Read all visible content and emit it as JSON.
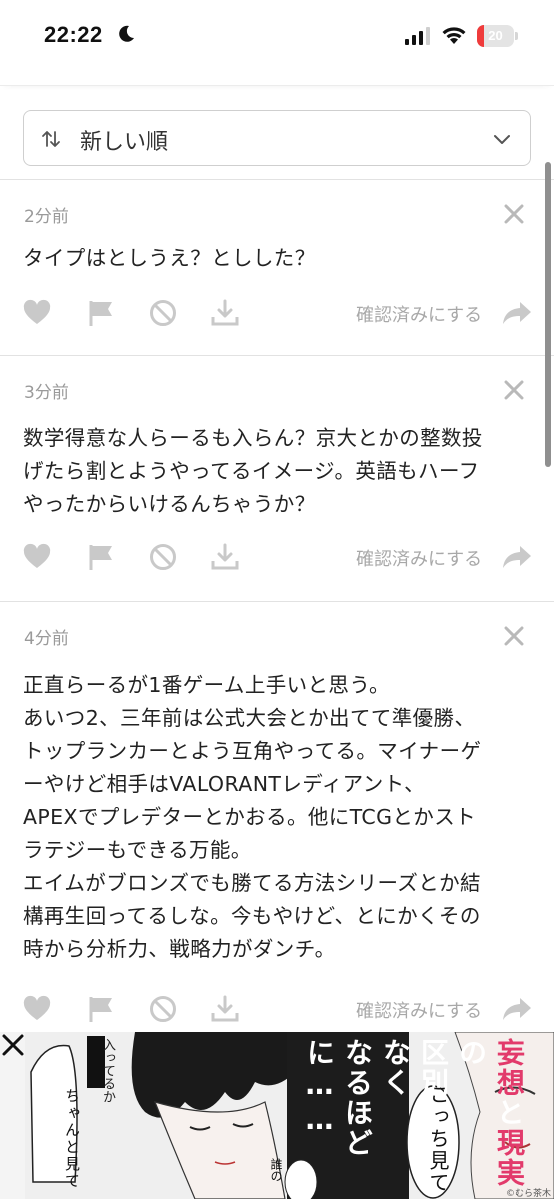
{
  "status_bar": {
    "time": "22:22",
    "battery": "20",
    "battery_level": 0.2,
    "battery_color": "#ef3b3b"
  },
  "sort": {
    "label": "新しい順"
  },
  "comments": [
    {
      "time": "2分前",
      "lines": [
        "タイプはとしうえ？としした？"
      ],
      "confirm_label": "確認済みにする"
    },
    {
      "time": "3分前",
      "lines": [
        "数学得意な人らーるも入らん？京大とかの整数投",
        "げたら割とようやってるイメージ。英語もハーフ",
        "やったからいけるんちゃうか？"
      ],
      "confirm_label": "確認済みにする"
    },
    {
      "time": "4分前",
      "lines": [
        "正直らーるが1番ゲーム上手いと思う。",
        "あいつ2、三年前は公式大会とか出てて準優勝、",
        "トップランカーとよう互角やってる。マイナーゲ",
        "ーやけど相手はVALORANTレディアント、",
        "APEXでプレデターとかおる。他にTCGとかスト",
        "ラテジーもできる万能。",
        "エイムがブロンズでも勝てる方法シリーズとか結",
        "構再生回ってるしな。今もやけど、とにかくその",
        "時から分析力、戦略力がダンチ。"
      ],
      "confirm_label": "確認済みにする"
    }
  ],
  "ad": {
    "speech_left": "ちゃんと見て",
    "speech_left2": "入ってるか",
    "headline_line1_pre": "",
    "headline_hl1": "妄想",
    "headline_mid": "と",
    "headline_hl2": "現実",
    "headline_end": "の",
    "headline_line2": "区別がつかなく",
    "headline_line3": "なるほどに……",
    "bubble": "こっち見て",
    "bubble2": "誰の",
    "credit": "©むら茶木屋"
  },
  "colors": {
    "icon_gray": "#c9c9c9",
    "accent_red": "#e23a6b"
  }
}
